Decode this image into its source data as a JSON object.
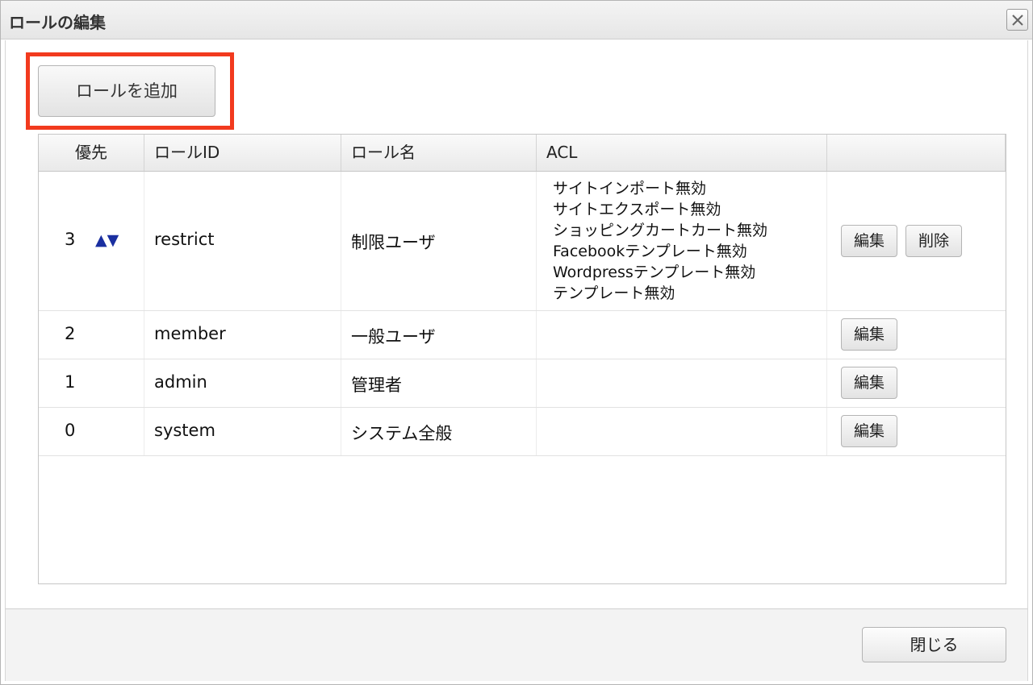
{
  "dialog": {
    "title": "ロールの編集",
    "close_icon": "close-icon"
  },
  "toolbar": {
    "add_role_label": "ロールを追加"
  },
  "table": {
    "headers": {
      "priority": "優先",
      "role_id": "ロールID",
      "role_name": "ロール名",
      "acl": "ACL",
      "actions": ""
    },
    "rows": [
      {
        "priority": "3",
        "sort_arrows": "▲▼",
        "role_id": "restrict",
        "role_name": "制限ユーザ",
        "acl": [
          "サイトインポート無効",
          "サイトエクスポート無効",
          "ショッピングカートカート無効",
          "Facebookテンプレート無効",
          "Wordpressテンプレート無効",
          "テンプレート無効"
        ],
        "edit_label": "編集",
        "delete_label": "削除"
      },
      {
        "priority": "2",
        "role_id": "member",
        "role_name": "一般ユーザ",
        "edit_label": "編集"
      },
      {
        "priority": "1",
        "role_id": "admin",
        "role_name": "管理者",
        "edit_label": "編集"
      },
      {
        "priority": "0",
        "role_id": "system",
        "role_name": "システム全般",
        "edit_label": "編集"
      }
    ]
  },
  "footer": {
    "close_label": "閉じる"
  },
  "colors": {
    "highlight": "#f23a1e",
    "sort_arrow": "#1a2fa0"
  }
}
